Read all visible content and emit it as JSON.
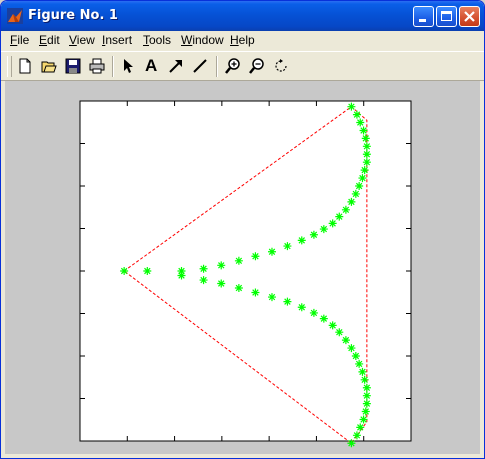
{
  "window": {
    "title": "Figure No. 1"
  },
  "menu": {
    "items": [
      {
        "label": "File",
        "u": "F",
        "rest": "ile"
      },
      {
        "label": "Edit",
        "u": "E",
        "rest": "dit"
      },
      {
        "label": "View",
        "u": "V",
        "rest": "iew"
      },
      {
        "label": "Insert",
        "u": "I",
        "rest": "nsert"
      },
      {
        "label": "Tools",
        "u": "T",
        "rest": "ools"
      },
      {
        "label": "Window",
        "u": "W",
        "rest": "indow"
      },
      {
        "label": "Help",
        "u": "H",
        "rest": "elp"
      }
    ]
  },
  "toolbar": {
    "tools": [
      "new-icon",
      "open-icon",
      "save-icon",
      "print-icon",
      "select-arrow-icon",
      "insert-text-icon",
      "insert-arrow-icon",
      "insert-line-icon",
      "zoom-in-icon",
      "zoom-out-icon",
      "rotate-icon"
    ],
    "text_tool_glyph": "A"
  },
  "chart_data": {
    "type": "scatter",
    "title": "",
    "xlabel": "",
    "ylabel": "",
    "xlim": [
      -1.5,
      1.5
    ],
    "ylim": [
      -1.5,
      1.5
    ],
    "grid": false,
    "ticks": {
      "x": 6,
      "y": 7
    },
    "colors": {
      "markers": "#00ff00",
      "triangle": "#ff0000",
      "axes_bg": "#ffffff",
      "figure_bg": "#c8c8c8"
    },
    "series": [
      {
        "marker": "*",
        "x": [
          -1.1,
          -0.89,
          -0.58,
          -0.38,
          -0.22,
          -0.06,
          0.09,
          0.24,
          0.38,
          0.51,
          0.62,
          0.71,
          0.79,
          0.85,
          0.91,
          0.96,
          1.0,
          1.03,
          1.06,
          1.08,
          1.1,
          1.1,
          1.1,
          1.09,
          1.07,
          1.04,
          1.01,
          0.96
        ],
        "y": [
          0.0,
          0.0,
          0.0,
          0.02,
          0.05,
          0.09,
          0.13,
          0.17,
          0.22,
          0.27,
          0.32,
          0.37,
          0.42,
          0.48,
          0.54,
          0.61,
          0.68,
          0.75,
          0.82,
          0.89,
          0.96,
          1.03,
          1.1,
          1.17,
          1.24,
          1.31,
          1.38,
          1.45
        ]
      },
      {
        "marker": "*",
        "x": [
          -0.58,
          -0.38,
          -0.22,
          -0.06,
          0.09,
          0.24,
          0.38,
          0.51,
          0.62,
          0.71,
          0.79,
          0.85,
          0.91,
          0.96,
          1.0,
          1.03,
          1.06,
          1.08,
          1.1,
          1.1,
          1.1,
          1.09,
          1.07,
          1.04,
          1.01,
          0.96
        ],
        "y": [
          -0.04,
          -0.08,
          -0.11,
          -0.15,
          -0.19,
          -0.23,
          -0.27,
          -0.32,
          -0.37,
          -0.42,
          -0.48,
          -0.54,
          -0.61,
          -0.68,
          -0.75,
          -0.82,
          -0.89,
          -0.96,
          -1.03,
          -1.1,
          -1.17,
          -1.24,
          -1.31,
          -1.38,
          -1.45,
          -1.52
        ]
      }
    ],
    "lines": [
      {
        "style": "dashed",
        "x": [
          -1.1,
          0.96,
          1.1,
          1.1,
          0.96,
          -1.1
        ],
        "y": [
          0.0,
          1.45,
          1.33,
          -1.33,
          -1.52,
          0.0
        ]
      }
    ]
  }
}
